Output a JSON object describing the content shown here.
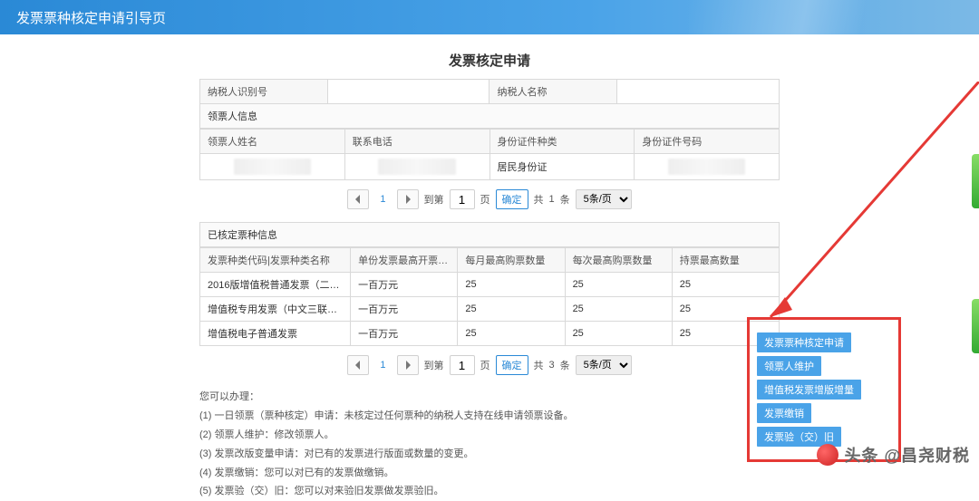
{
  "header": {
    "title": "发票票种核定申请引导页"
  },
  "page": {
    "title": "发票核定申请"
  },
  "taxpayer": {
    "id_label": "纳税人识别号",
    "name_label": "纳税人名称",
    "id_value": "",
    "name_value": ""
  },
  "recipient": {
    "section": "领票人信息",
    "cols": {
      "name": "领票人姓名",
      "phone": "联系电话",
      "id_type": "身份证件种类",
      "id_no": "身份证件号码"
    },
    "row": {
      "name": "",
      "phone": "",
      "id_type": "居民身份证",
      "id_no": ""
    }
  },
  "pager1": {
    "current": "1",
    "jump_label_pre": "到第",
    "jump_value": "1",
    "jump_label_post": "页",
    "confirm": "确定",
    "total_pre": "共",
    "total": "1",
    "total_post": "条",
    "page_size": "5条/页"
  },
  "verified": {
    "section": "已核定票种信息",
    "cols": {
      "code_name": "发票种类代码|发票种类名称",
      "max_amount": "单份发票最高开票金额",
      "monthly_max": "每月最高购票数量",
      "per_max": "每次最高购票数量",
      "hold_max": "持票最高数量"
    },
    "rows": [
      {
        "code_name": "2016版增值税普通发票（二联…",
        "max_amount": "一百万元",
        "monthly_max": "25",
        "per_max": "25",
        "hold_max": "25"
      },
      {
        "code_name": "增值税专用发票（中文三联无…",
        "max_amount": "一百万元",
        "monthly_max": "25",
        "per_max": "25",
        "hold_max": "25"
      },
      {
        "code_name": "增值税电子普通发票",
        "max_amount": "一百万元",
        "monthly_max": "25",
        "per_max": "25",
        "hold_max": "25"
      }
    ]
  },
  "pager2": {
    "current": "1",
    "jump_label_pre": "到第",
    "jump_value": "1",
    "jump_label_post": "页",
    "confirm": "确定",
    "total_pre": "共",
    "total": "3",
    "total_post": "条",
    "page_size": "5条/页"
  },
  "help": {
    "heading": "您可以办理：",
    "lines": [
      "(1) 一日领票（票种核定）申请：未核定过任何票种的纳税人支持在线申请领票设备。",
      "(2) 领票人维护：修改领票人。",
      "(3) 发票改版变量申请：对已有的发票进行版面或数量的变更。",
      "(4) 发票缴销：您可以对已有的发票做缴销。",
      "(5) 发票验（交）旧：您可以对来验旧发票做发票验旧。"
    ]
  },
  "actions": {
    "items": [
      "发票票种核定申请",
      "领票人维护",
      "增值税发票增版增量",
      "发票缴销",
      "发票验（交）旧"
    ]
  },
  "watermark": {
    "text": "头条 @昌尧财税"
  }
}
